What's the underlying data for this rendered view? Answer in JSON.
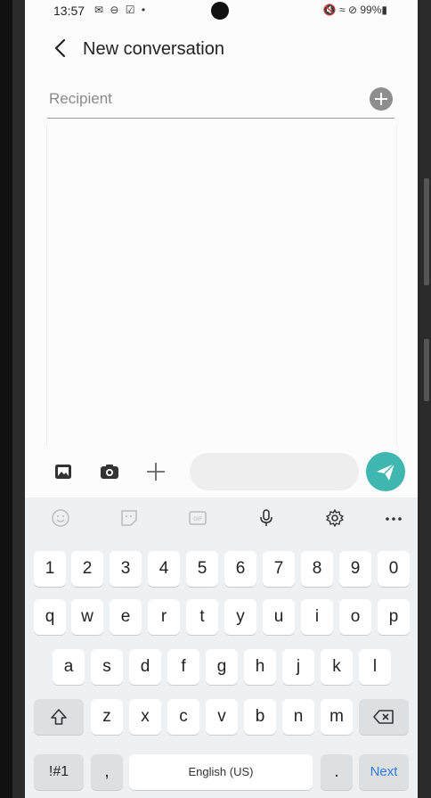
{
  "status_bar": {
    "time": "13:57",
    "notifications": "✉ ⊖ ☑ •",
    "right": "🔇 ≈ ⊘ 99%▮"
  },
  "header": {
    "title": "New conversation"
  },
  "recipient": {
    "placeholder": "Recipient"
  },
  "compose": {
    "placeholder": ""
  },
  "keyboard": {
    "number_row": [
      "1",
      "2",
      "3",
      "4",
      "5",
      "6",
      "7",
      "8",
      "9",
      "0"
    ],
    "row1": [
      "q",
      "w",
      "e",
      "r",
      "t",
      "y",
      "u",
      "i",
      "o",
      "p"
    ],
    "row2": [
      "a",
      "s",
      "d",
      "f",
      "g",
      "h",
      "j",
      "k",
      "l"
    ],
    "row3": [
      "z",
      "x",
      "c",
      "v",
      "b",
      "n",
      "m"
    ],
    "symbols_key": "!#1",
    "comma_key": ",",
    "space_key": "English (US)",
    "period_key": ".",
    "next_key": "Next"
  },
  "colors": {
    "send": "#3fb7b0",
    "next": "#2f79e6"
  }
}
